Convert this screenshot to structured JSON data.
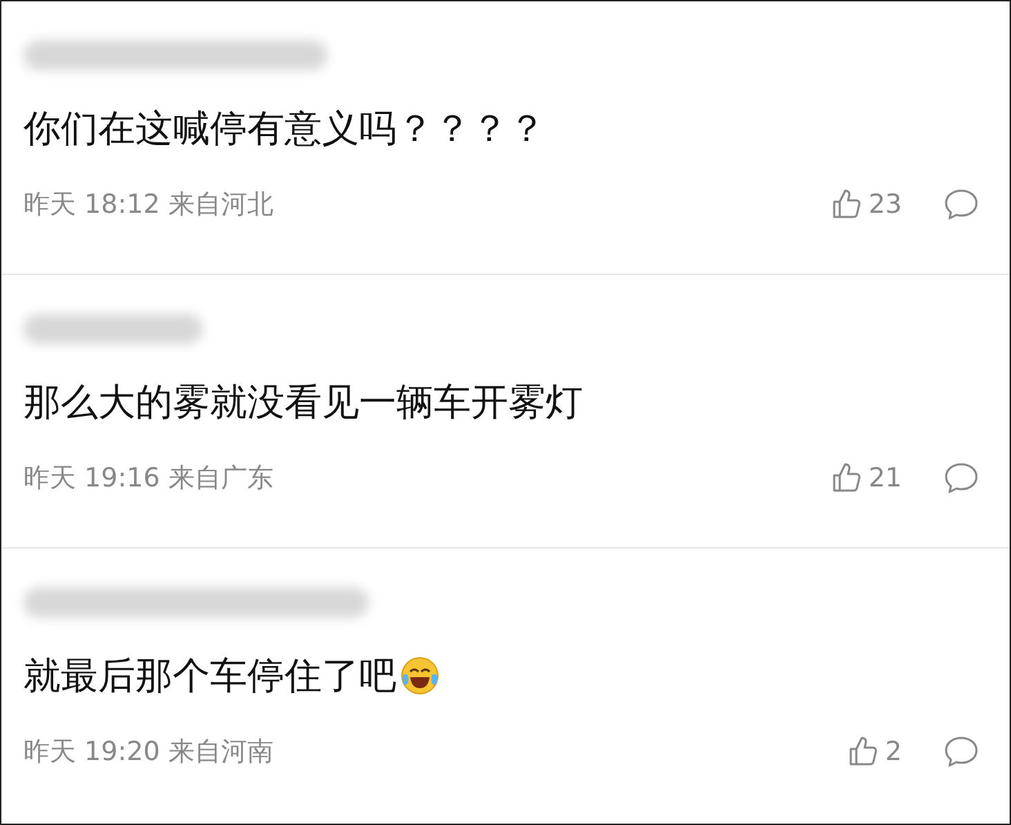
{
  "comments": [
    {
      "text": "你们在这喊停有意义吗？？？？",
      "time": "昨天 18:12",
      "location": "来自河北",
      "likes": "23"
    },
    {
      "text": "那么大的雾就没看见一辆车开雾灯",
      "time": "昨天 19:16",
      "location": "来自广东",
      "likes": "21"
    },
    {
      "text": "就最后那个车停住了吧",
      "emoji": true,
      "time": "昨天 19:20",
      "location": "来自河南",
      "likes": "2"
    }
  ]
}
